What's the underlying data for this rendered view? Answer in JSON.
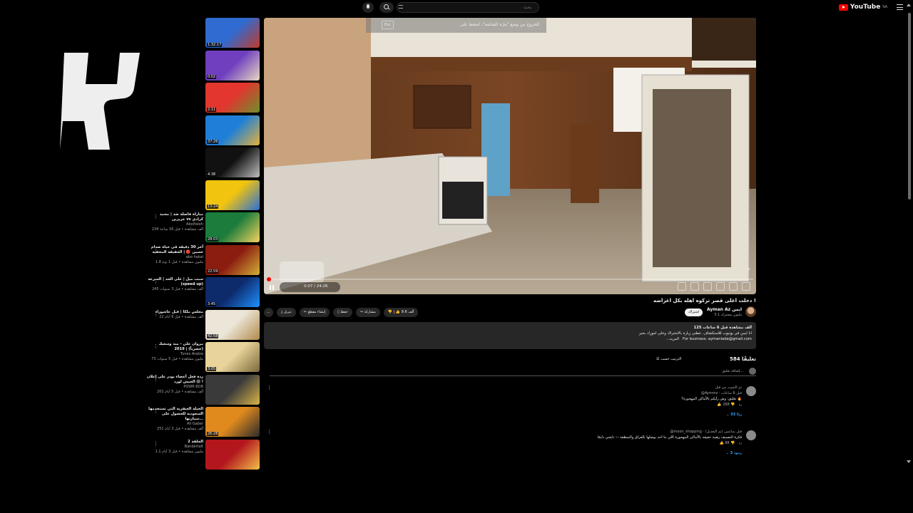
{
  "topbar": {
    "search_placeholder": "بحث",
    "brand": "YouTube",
    "brand_region": "SA"
  },
  "player": {
    "esc_key": "Esc",
    "esc_message": "للخروج من وضع \"ملء الشاشة\"، اضغط على",
    "time": "0:07 / 24:26",
    "progress": 0.005,
    "chapter_badge": "F"
  },
  "video": {
    "title": "دخلت اغلى قصر تركوه اهله بكل اغراضه !",
    "channel": "Ayman Az ايمن",
    "subscribers": "3.1 مليون مشترك",
    "subscribe": "اشتراك",
    "likes": "9.6 ألف",
    "share": "مشاركة",
    "save": "حفظ",
    "clip": "إنشاء مقطع",
    "download": "تنزيل",
    "more": "..."
  },
  "description": {
    "stats": "125 ألف مشاهدة  قبل 6 ساعات",
    "line1": "انا ايمن في يوتيوب للاستكشاف. عطني زيارة بالاشتراك وخلي امورك بخير",
    "line2": "For business: aymanlada@gmail.com",
    "more": "...المزيد"
  },
  "comments": {
    "count": "584 تعليقًا",
    "sort": "الترتيب حسب",
    "add_placeholder": "إضافة تعليق...",
    "items": [
      {
        "author": "@Aymmz",
        "pinned": "تم التثبيت من قبل",
        "time": "قبل 6 ساعات",
        "text": "تعليق: وش رأيكم بالأماكن المهجورة؟ 🔥",
        "likes": "288",
        "replies": "33 ردًا"
      },
      {
        "author": "@moon_shopping",
        "pinned": "",
        "time": "قبل ساعتين (تم التعديل)",
        "text": "فكرة التصنيف رهيبة حقيقة بالأماكن المهجورة اللي ما احد يوصلها بالعراق والمنطقة — تابعني دايمًا",
        "likes": "88",
        "replies": "3 ردود"
      }
    ]
  },
  "recommendations": [
    {
      "title": "",
      "channel": "",
      "stats": "",
      "duration": "1:32:17",
      "colors": [
        "#2f6bd1",
        "#c03a2b"
      ]
    },
    {
      "title": "",
      "channel": "",
      "stats": "",
      "duration": "0:02",
      "colors": [
        "#6f3fbf",
        "#e8d8c0"
      ]
    },
    {
      "title": "",
      "channel": "",
      "stats": "",
      "duration": "2:11",
      "colors": [
        "#e2362f",
        "#6e8f2c"
      ]
    },
    {
      "title": "",
      "channel": "",
      "stats": "",
      "duration": "37:26",
      "colors": [
        "#1f7fd8",
        "#e5b33a"
      ]
    },
    {
      "title": "",
      "channel": "",
      "stats": "",
      "duration": "4:38",
      "colors": [
        "#111111",
        "#bfbfbf"
      ]
    },
    {
      "title": "",
      "channel": "",
      "stats": "",
      "duration": "13:24",
      "colors": [
        "#f1c40f",
        "#2a6fd6"
      ]
    },
    {
      "title": "مباراة فاصلة ضد | محمد عزيزين vs كرادي",
      "channel": "Abolfateh",
      "stats": "234 ألف مشاهدة • قبل 16 ساعة",
      "duration": "28:03",
      "colors": [
        "#1b7c3c",
        "#f4d35e"
      ]
    },
    {
      "title": "آخر 30 دقيقة في حياة صدام حسين 🔴 | الحقيقة المخفية",
      "channel": "abo hakal",
      "stats": "1.8 مليون مشاهدة • قبل 1 يوم",
      "duration": "22:59",
      "colors": [
        "#8a1c10",
        "#d4af37"
      ]
    },
    {
      "title": "سبب ميل | على الحد | السرعة (speed up)",
      "channel": "",
      "stats": "245 ألف مشاهدة • قبل 3 سنوات",
      "duration": "3:45",
      "colors": [
        "#0d2a6b",
        "#1e90ff"
      ]
    },
    {
      "title": "مجلس ملكا | قبل عاشوراء",
      "channel": "",
      "stats": "22 ألف مشاهدة • قبل 6 أيام",
      "duration": "42:58",
      "colors": [
        "#ece6d8",
        "#b08a4a"
      ]
    },
    {
      "title": "مروان علي - منذ وسعيك (حصرياً) | 2019",
      "channel": "Tunes Arabia",
      "stats": "73 مليون مشاهدة • قبل 5 سنوات",
      "duration": "3:05",
      "colors": [
        "#e8d49a",
        "#7a6a3a"
      ]
    },
    {
      "title": "ردة فعل أعضاء بودر على إعلان الجيش لورد 😱 !",
      "channel": "POWR BOB",
      "stats": "201 ألف مشاهدة • قبل 5 أيام",
      "duration": "",
      "colors": [
        "#3a3a3a",
        "#d9b44a"
      ]
    },
    {
      "title": "الحيلة العبقرية التي تستخدمها السعودية للحصول على سيارتها...",
      "channel": "Ali Gaber",
      "stats": "251 ألف مشاهدة • قبل 3 أيام",
      "duration": "26:28",
      "colors": [
        "#e08a1e",
        "#2b2b2b"
      ]
    },
    {
      "title": "الحلقة 2",
      "channel": "Bandertalt",
      "stats": "1.1 مليون مشاهدة • قبل 3 أيام",
      "duration": "",
      "colors": [
        "#b3171d",
        "#f3c04a"
      ]
    }
  ]
}
